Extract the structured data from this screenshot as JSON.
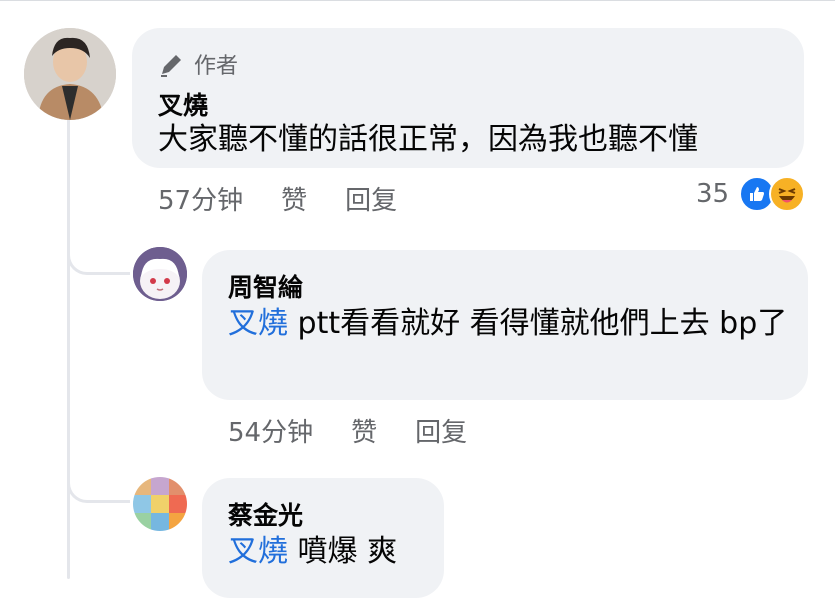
{
  "comments": [
    {
      "author_badge": "作者",
      "name": "叉燒",
      "text": "大家聽不懂的話很正常，因為我也聽不懂",
      "time": "57分钟",
      "like_label": "赞",
      "reply_label": "回复",
      "reaction_count": "35",
      "reactions": [
        "like-icon",
        "haha-icon"
      ],
      "colors": {
        "like": "#1877f2",
        "haha": "#f7b125"
      }
    },
    {
      "name": "周智綸",
      "mention": "叉燒",
      "text": " ptt看看就好 看得懂就他們上去 bp了",
      "time": "54分钟",
      "like_label": "赞",
      "reply_label": "回复"
    },
    {
      "name": "蔡金光",
      "mention": "叉燒",
      "text": " 噴爆 爽"
    }
  ],
  "colors": {
    "mention": "#216fdb",
    "meta": "#65676b",
    "bubble": "#f0f2f5"
  }
}
